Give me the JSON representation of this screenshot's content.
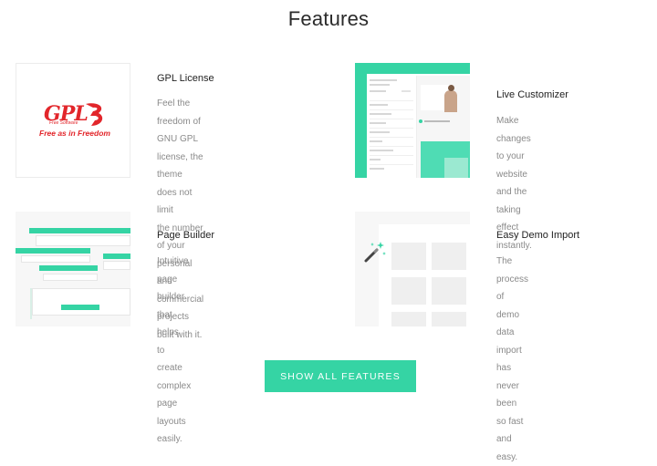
{
  "section": {
    "title": "Features"
  },
  "features": [
    {
      "title": "GPL License",
      "desc": [
        "Feel the freedom of GNU GPL",
        "license, the theme does not limit",
        "the number of your personal and",
        "commercial projects built with it."
      ],
      "logo": {
        "main": "GPL",
        "sub": "Free Software",
        "tagline": "Free as in Freedom",
        "color": "#e2262b"
      }
    },
    {
      "title": "Live Customizer",
      "desc": [
        "Make changes to your website",
        "and the taking effect instantly."
      ]
    },
    {
      "title": "Page Builder",
      "desc": [
        "Intuitive page builder that helps",
        "to create complex page layouts",
        "easily."
      ]
    },
    {
      "title": "Easy Demo Import",
      "desc": [
        "The process of demo data",
        "import has never been so fast",
        "and easy."
      ]
    }
  ],
  "cta": {
    "label": "SHOW ALL FEATURES",
    "color": "#35d4a4"
  },
  "icons": {
    "wand": "magic-wand-icon"
  }
}
